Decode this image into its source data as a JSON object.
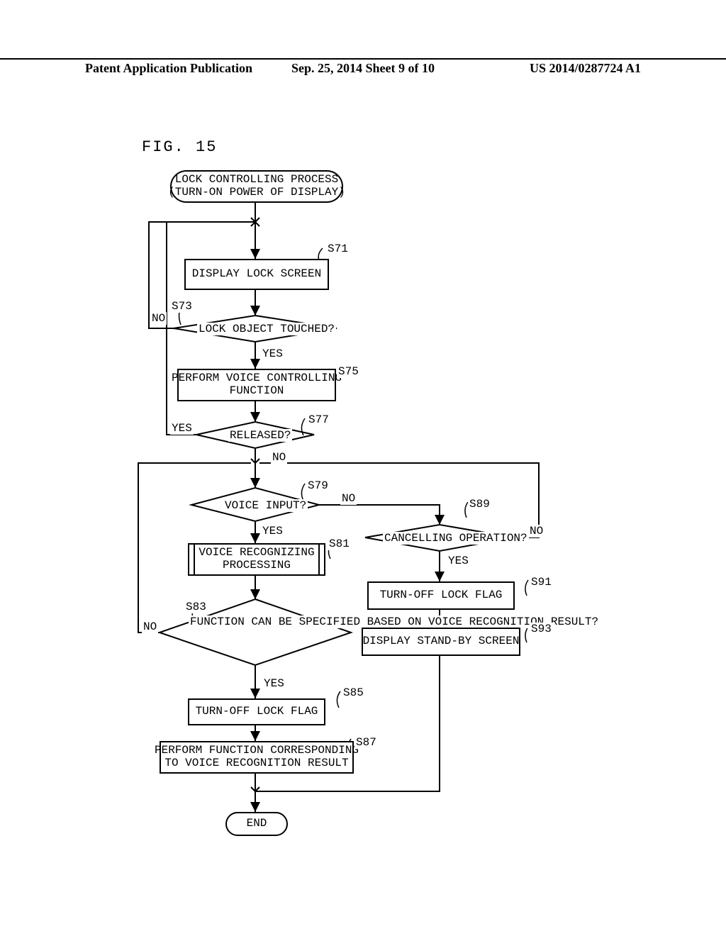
{
  "header": {
    "left": "Patent Application Publication",
    "middle": "Sep. 25, 2014  Sheet 9 of 10",
    "right": "US 2014/0287724 A1"
  },
  "figure_label": "FIG. 15",
  "nodes": {
    "start": "LOCK CONTROLLING PROCESS\n(TURN-ON POWER OF DISPLAY)",
    "s71": "DISPLAY LOCK SCREEN",
    "s73": "LOCK OBJECT TOUCHED?",
    "s75": "PERFORM VOICE CONTROLLING\nFUNCTION",
    "s77": "RELEASED?",
    "s79": "VOICE INPUT?",
    "s81": "VOICE RECOGNIZING\nPROCESSING",
    "s83": "FUNCTION CAN BE\nSPECIFIED BASED ON VOICE\nRECOGNITION RESULT?",
    "s85": "TURN-OFF LOCK FLAG",
    "s87": "PERFORM FUNCTION CORRESPONDING\nTO VOICE RECOGNITION RESULT",
    "s89": "CANCELLING OPERATION?",
    "s91": "TURN-OFF LOCK FLAG",
    "s93": "DISPLAY STAND-BY SCREEN",
    "end": "END"
  },
  "step_labels": {
    "s71": "S71",
    "s73": "S73",
    "s75": "S75",
    "s77": "S77",
    "s79": "S79",
    "s81": "S81",
    "s83": "S83",
    "s85": "S85",
    "s87": "S87",
    "s89": "S89",
    "s91": "S91",
    "s93": "S93"
  },
  "branch_labels": {
    "yes": "YES",
    "no": "NO"
  }
}
